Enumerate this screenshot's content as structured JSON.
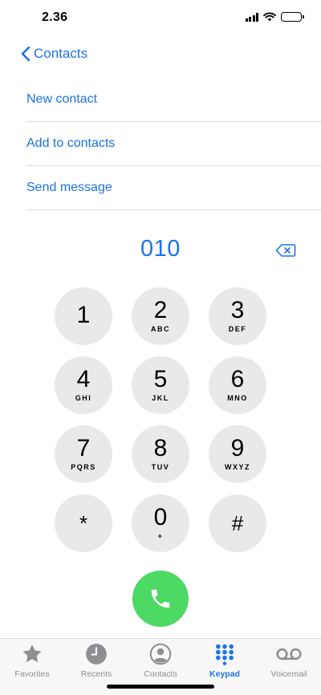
{
  "status_bar": {
    "time": "2.36",
    "icons": [
      "signal-icon",
      "wifi-icon",
      "battery-icon"
    ]
  },
  "nav": {
    "back_label": "Contacts",
    "back_icon": "chevron-left-icon"
  },
  "options": [
    {
      "label": "New contact"
    },
    {
      "label": "Add to contacts"
    },
    {
      "label": "Send message"
    }
  ],
  "dialed_number": "010",
  "keypad": {
    "keys": [
      {
        "digit": "1",
        "letters": ""
      },
      {
        "digit": "2",
        "letters": "ABC"
      },
      {
        "digit": "3",
        "letters": "DEF"
      },
      {
        "digit": "4",
        "letters": "GHI"
      },
      {
        "digit": "5",
        "letters": "JKL"
      },
      {
        "digit": "6",
        "letters": "MNO"
      },
      {
        "digit": "7",
        "letters": "PQRS"
      },
      {
        "digit": "8",
        "letters": "TUV"
      },
      {
        "digit": "9",
        "letters": "WXYZ"
      },
      {
        "digit": "*",
        "letters": ""
      },
      {
        "digit": "0",
        "letters": "+"
      },
      {
        "digit": "#",
        "letters": ""
      }
    ]
  },
  "tabs": [
    {
      "label": "Favorites",
      "icon": "star-icon",
      "active": false
    },
    {
      "label": "Recents",
      "icon": "clock-icon",
      "active": false
    },
    {
      "label": "Contacts",
      "icon": "person-circle-icon",
      "active": false
    },
    {
      "label": "Keypad",
      "icon": "keypad-grid-icon",
      "active": true
    },
    {
      "label": "Voicemail",
      "icon": "voicemail-icon",
      "active": false
    }
  ],
  "colors": {
    "accent": "#1a73e8",
    "call_green": "#4cd964",
    "key_gray": "#e9e9ea",
    "inactive_tab": "#8e8e93"
  }
}
